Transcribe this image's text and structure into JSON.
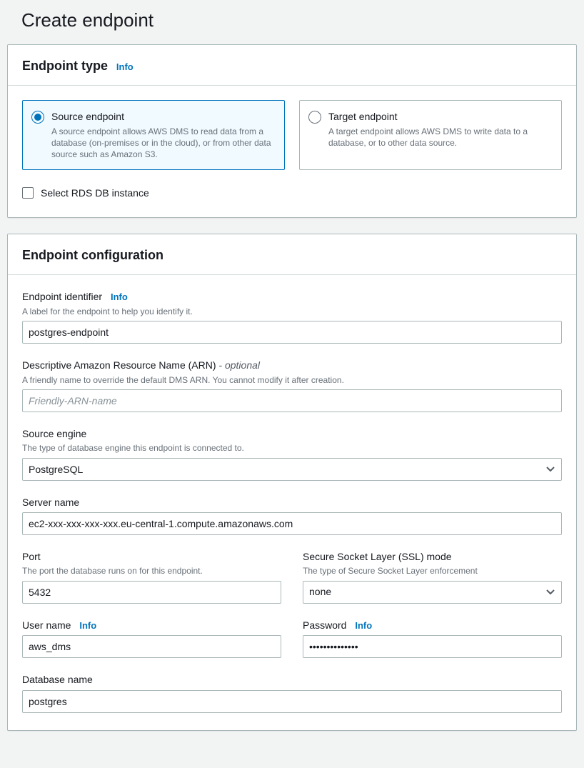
{
  "page_title": "Create endpoint",
  "info_label": "Info",
  "endpoint_type": {
    "panel_title": "Endpoint type",
    "source": {
      "title": "Source endpoint",
      "desc": "A source endpoint allows AWS DMS to read data from a database (on-premises or in the cloud), or from other data source such as Amazon S3."
    },
    "target": {
      "title": "Target endpoint",
      "desc": "A target endpoint allows AWS DMS to write data to a database, or to other data source."
    },
    "rds_checkbox_label": "Select RDS DB instance"
  },
  "config": {
    "panel_title": "Endpoint configuration",
    "identifier": {
      "label": "Endpoint identifier",
      "hint": "A label for the endpoint to help you identify it.",
      "value": "postgres-endpoint"
    },
    "arn": {
      "label": "Descriptive Amazon Resource Name (ARN)",
      "optional": " - optional",
      "hint": "A friendly name to override the default DMS ARN. You cannot modify it after creation.",
      "placeholder": "Friendly-ARN-name",
      "value": ""
    },
    "engine": {
      "label": "Source engine",
      "hint": "The type of database engine this endpoint is connected to.",
      "value": "PostgreSQL"
    },
    "server": {
      "label": "Server name",
      "value": "ec2-xxx-xxx-xxx-xxx.eu-central-1.compute.amazonaws.com"
    },
    "port": {
      "label": "Port",
      "hint": "The port the database runs on for this endpoint.",
      "value": "5432"
    },
    "ssl": {
      "label": "Secure Socket Layer (SSL) mode",
      "hint": "The type of Secure Socket Layer enforcement",
      "value": "none"
    },
    "user": {
      "label": "User name",
      "value": "aws_dms"
    },
    "password": {
      "label": "Password",
      "value": "••••••••••••••"
    },
    "database": {
      "label": "Database name",
      "value": "postgres"
    }
  }
}
